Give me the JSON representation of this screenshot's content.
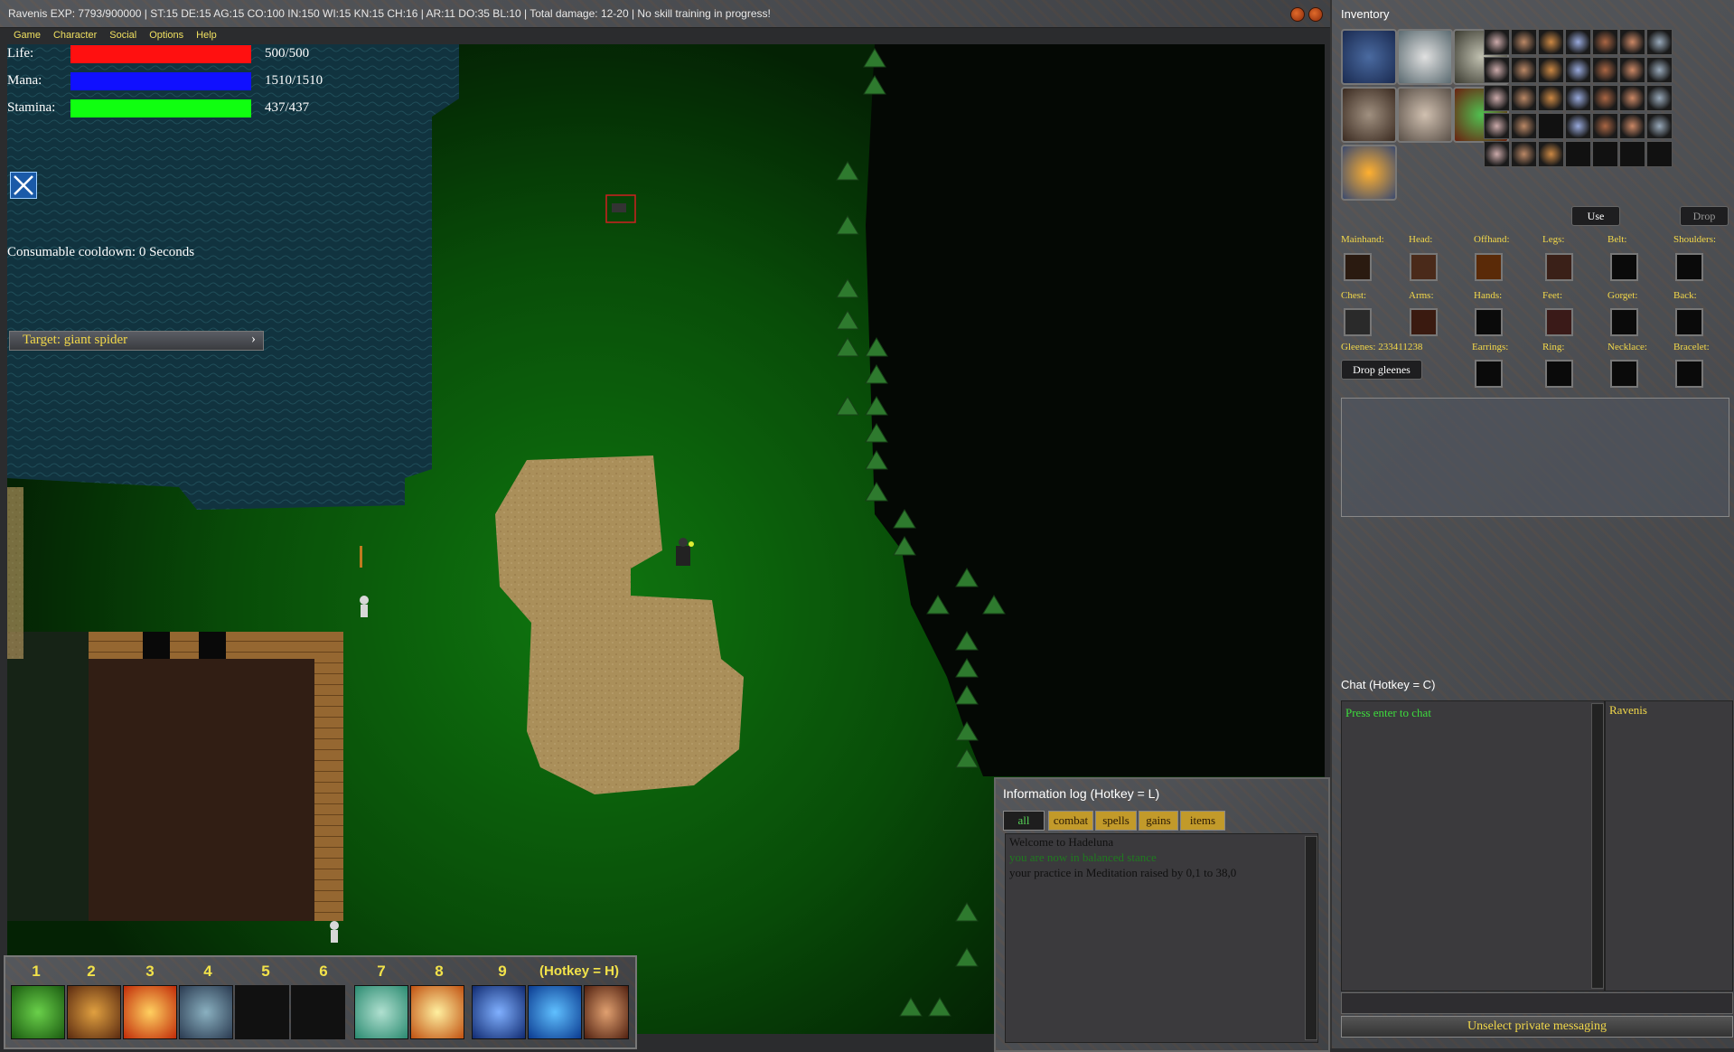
{
  "window": {
    "title": "Ravenis   EXP: 7793/900000 | ST:15 DE:15 AG:15 CO:100 IN:150 WI:15 KN:15 CH:16 | AR:11 DO:35 BL:10 | Total damage: 12-20 |    No skill training in progress!"
  },
  "menu": [
    "Game",
    "Character",
    "Social",
    "Options",
    "Help"
  ],
  "stats": {
    "life": {
      "label": "Life:",
      "value": "500/500",
      "fraction": 1.0,
      "color": "#ff1010"
    },
    "mana": {
      "label": "Mana:",
      "value": "1510/1510",
      "fraction": 1.0,
      "color": "#1010ff"
    },
    "stamina": {
      "label": "Stamina:",
      "value": "437/437",
      "fraction": 1.0,
      "color": "#10ff10"
    }
  },
  "cooldown": "Consumable cooldown: 0 Seconds",
  "target": {
    "label": "Target: giant spider",
    "arrow": "›"
  },
  "hotbar": {
    "numbers": [
      "1",
      "2",
      "3",
      "4",
      "5",
      "6",
      "7",
      "8",
      "9"
    ],
    "hotkey_label": "(Hotkey = H)",
    "slots": [
      "leaf-icon",
      "claw-icon",
      "fireball-icon",
      "mace-icon",
      "empty",
      "empty",
      "breath-icon",
      "burst-icon",
      "crossed-swords-icon",
      "shield-icon",
      "gauntlet-icon"
    ]
  },
  "infolog": {
    "header": "Information log (Hotkey = L)",
    "tabs": [
      "all",
      "combat",
      "spells",
      "gains",
      "items"
    ],
    "lines": [
      {
        "text": "Welcome to Hadeluna",
        "color": "#101010"
      },
      {
        "text": "you are now in balanced stance",
        "color": "#1f7a1f"
      },
      {
        "text": "your practice in Meditation raised by 0,1 to 38,0",
        "color": "#101010"
      }
    ]
  },
  "inventory": {
    "title": "Inventory",
    "use_label": "Use",
    "drop_label": "Drop",
    "gleenes": "Gleenes: 233411238",
    "drop_gleenes": "Drop gleenes",
    "equip_labels": {
      "mainhand": "Mainhand:",
      "head": "Head:",
      "offhand": "Offhand:",
      "legs": "Legs:",
      "belt": "Belt:",
      "shoulders": "Shoulders:",
      "chest": "Chest:",
      "arms": "Arms:",
      "hands": "Hands:",
      "feet": "Feet:",
      "gorget": "Gorget:",
      "back": "Back:",
      "earrings": "Earrings:",
      "ring": "Ring:",
      "necklace": "Necklace:",
      "bracelet": "Bracelet:"
    }
  },
  "chat": {
    "header": "Chat (Hotkey = C)",
    "prompt": "Press enter to chat",
    "user": "Ravenis",
    "unselect": "Unselect private messaging"
  }
}
